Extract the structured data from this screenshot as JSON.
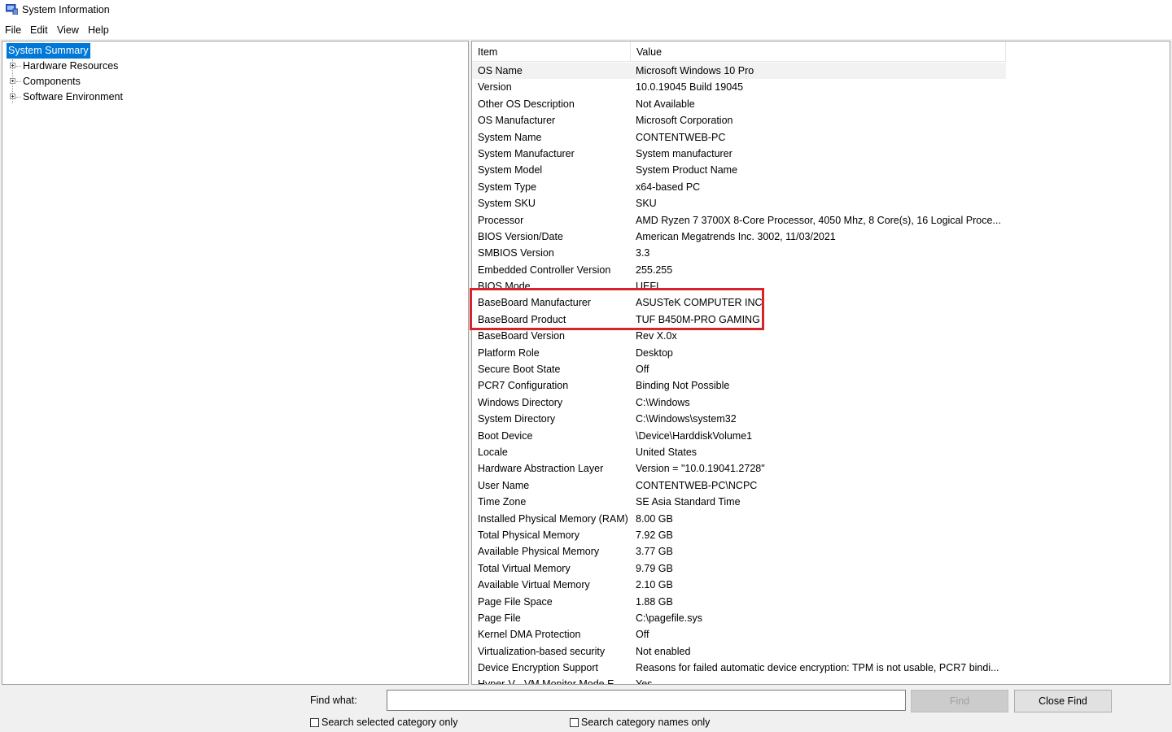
{
  "window": {
    "title": "System Information",
    "icon": "system-information-icon"
  },
  "menu": [
    "File",
    "Edit",
    "View",
    "Help"
  ],
  "tree": [
    {
      "label": "System Summary",
      "selected": true,
      "expandable": false
    },
    {
      "label": "Hardware Resources",
      "expandable": true
    },
    {
      "label": "Components",
      "expandable": true
    },
    {
      "label": "Software Environment",
      "expandable": true
    }
  ],
  "table": {
    "headers": {
      "item": "Item",
      "value": "Value"
    },
    "rows": [
      [
        "OS Name",
        "Microsoft Windows 10 Pro"
      ],
      [
        "Version",
        "10.0.19045 Build 19045"
      ],
      [
        "Other OS Description",
        "Not Available"
      ],
      [
        "OS Manufacturer",
        "Microsoft Corporation"
      ],
      [
        "System Name",
        "CONTENTWEB-PC"
      ],
      [
        "System Manufacturer",
        "System manufacturer"
      ],
      [
        "System Model",
        "System Product Name"
      ],
      [
        "System Type",
        "x64-based PC"
      ],
      [
        "System SKU",
        "SKU"
      ],
      [
        "Processor",
        "AMD Ryzen 7 3700X 8-Core Processor, 4050 Mhz, 8 Core(s), 16 Logical Proce..."
      ],
      [
        "BIOS Version/Date",
        "American Megatrends Inc. 3002, 11/03/2021"
      ],
      [
        "SMBIOS Version",
        "3.3"
      ],
      [
        "Embedded Controller Version",
        "255.255"
      ],
      [
        "BIOS Mode",
        "UEFI"
      ],
      [
        "BaseBoard Manufacturer",
        "ASUSTeK COMPUTER INC."
      ],
      [
        "BaseBoard Product",
        "TUF B450M-PRO GAMING"
      ],
      [
        "BaseBoard Version",
        "Rev X.0x"
      ],
      [
        "Platform Role",
        "Desktop"
      ],
      [
        "Secure Boot State",
        "Off"
      ],
      [
        "PCR7 Configuration",
        "Binding Not Possible"
      ],
      [
        "Windows Directory",
        "C:\\Windows"
      ],
      [
        "System Directory",
        "C:\\Windows\\system32"
      ],
      [
        "Boot Device",
        "\\Device\\HarddiskVolume1"
      ],
      [
        "Locale",
        "United States"
      ],
      [
        "Hardware Abstraction Layer",
        "Version = \"10.0.19041.2728\""
      ],
      [
        "User Name",
        "CONTENTWEB-PC\\NCPC"
      ],
      [
        "Time Zone",
        "SE Asia Standard Time"
      ],
      [
        "Installed Physical Memory (RAM)",
        "8.00 GB"
      ],
      [
        "Total Physical Memory",
        "7.92 GB"
      ],
      [
        "Available Physical Memory",
        "3.77 GB"
      ],
      [
        "Total Virtual Memory",
        "9.79 GB"
      ],
      [
        "Available Virtual Memory",
        "2.10 GB"
      ],
      [
        "Page File Space",
        "1.88 GB"
      ],
      [
        "Page File",
        "C:\\pagefile.sys"
      ],
      [
        "Kernel DMA Protection",
        "Off"
      ],
      [
        "Virtualization-based security",
        "Not enabled"
      ],
      [
        "Device Encryption Support",
        "Reasons for failed automatic device encryption: TPM is not usable, PCR7 bindi..."
      ],
      [
        "Hyper-V - VM Monitor Mode E...",
        "Yes"
      ]
    ]
  },
  "find": {
    "label": "Find what:",
    "value": "",
    "find_button": "Find",
    "close_button": "Close Find",
    "option_selected_category": "Search selected category only",
    "option_category_names": "Search category names only"
  },
  "colors": {
    "selection": "#0078d7",
    "highlight_box": "#d8232a"
  }
}
